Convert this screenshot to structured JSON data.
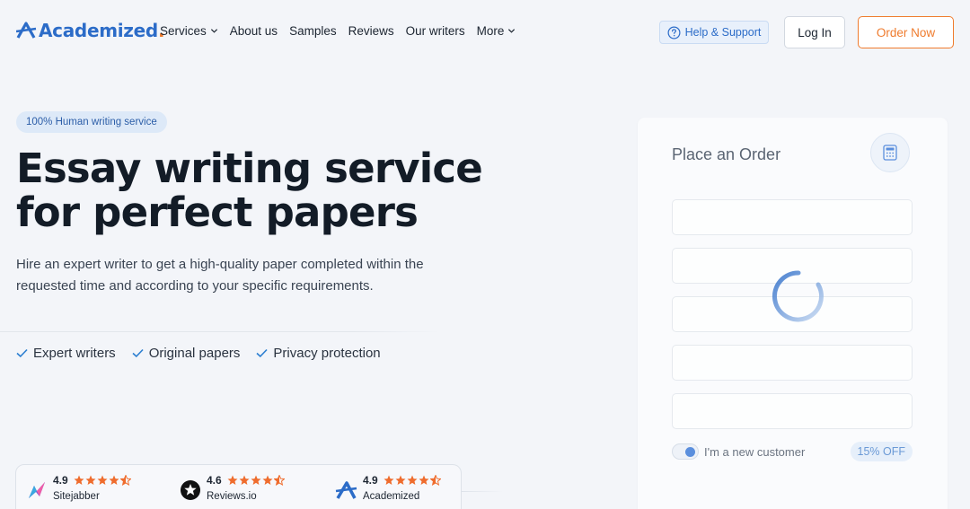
{
  "header": {
    "logo_text": "Academized",
    "logo_dot": ".",
    "nav": [
      {
        "label": "Services",
        "has_dropdown": true
      },
      {
        "label": "About us",
        "has_dropdown": false
      },
      {
        "label": "Samples",
        "has_dropdown": false
      },
      {
        "label": "Reviews",
        "has_dropdown": false
      },
      {
        "label": "Our writers",
        "has_dropdown": false
      },
      {
        "label": "More",
        "has_dropdown": true
      }
    ],
    "help_label": "Help & Support",
    "login_label": "Log In",
    "order_label": "Order Now"
  },
  "hero": {
    "badge": "100% Human writing service",
    "title_line1": "Essay writing service",
    "title_line2": "for perfect papers",
    "subtitle": "Hire an expert writer to get a high-quality paper completed within the requested time and according to your specific requirements.",
    "features": [
      "Expert writers",
      "Original papers",
      "Privacy protection"
    ]
  },
  "ratings": [
    {
      "score": "4.9",
      "name": "Sitejabber",
      "icon": "sitejabber-icon"
    },
    {
      "score": "4.6",
      "name": "Reviews.io",
      "icon": "reviews-io-icon"
    },
    {
      "score": "4.9",
      "name": "Academized",
      "icon": "academized-icon"
    }
  ],
  "order_panel": {
    "title": "Place an Order",
    "field_count": 5,
    "toggle_label": "I'm a new customer",
    "toggle_on": true,
    "discount": "15% OFF"
  },
  "colors": {
    "brand": "#2c6cc8",
    "accent": "#ef7b2d",
    "star": "#ef6c2d",
    "background": "#f3f5f9"
  }
}
